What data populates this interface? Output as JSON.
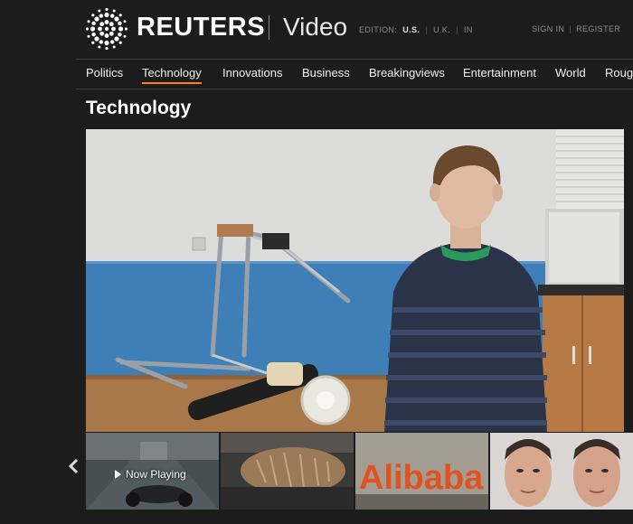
{
  "brand": {
    "name": "REUTERS",
    "section": "Video"
  },
  "edition": {
    "label": "EDITION:",
    "options": [
      "U.S.",
      "U.K.",
      "IN"
    ],
    "selected": "U.S."
  },
  "account": {
    "sign_in": "SIGN IN",
    "register": "REGISTER"
  },
  "nav": {
    "items": [
      "Politics",
      "Technology",
      "Innovations",
      "Business",
      "Breakingviews",
      "Entertainment",
      "World",
      "Roug"
    ],
    "active": "Technology"
  },
  "page": {
    "title": "Technology"
  },
  "carousel": {
    "now_playing": "Now Playing",
    "thumb3_text": "Alibaba"
  },
  "colors": {
    "accent": "#ff8000",
    "background": "#1c1c1c",
    "logo_orange": "#ff8000"
  },
  "icons": [
    "reuters-logo-icon",
    "chevron-left-icon",
    "play-icon"
  ]
}
